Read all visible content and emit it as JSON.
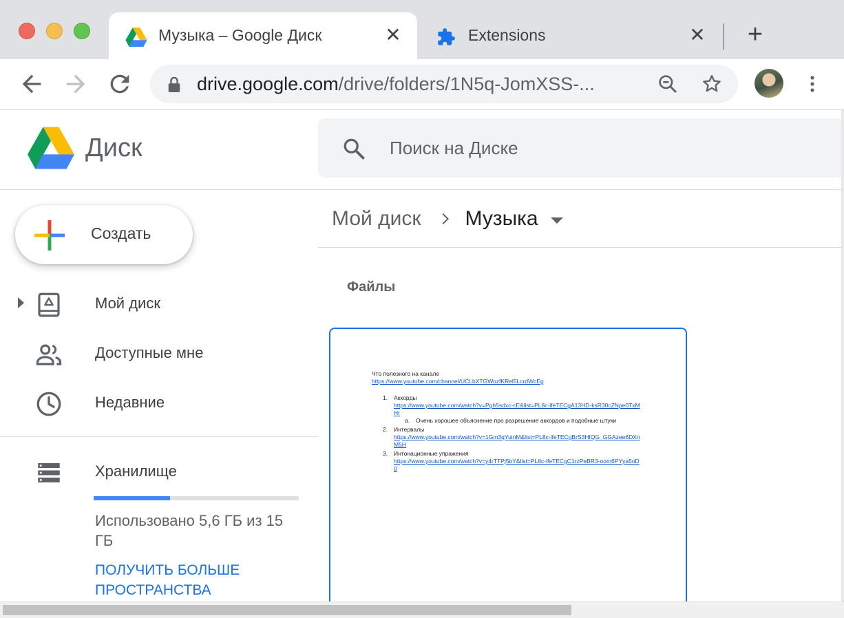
{
  "browser": {
    "tabs": [
      {
        "title": "Музыка – Google Диск",
        "close": "✕"
      },
      {
        "title": "Extensions",
        "close": "✕"
      }
    ],
    "new_tab": "+",
    "url_host": "drive.google.com",
    "url_path": "/drive/folders/1N5q-JomXSS-..."
  },
  "drive": {
    "app_name": "Диск",
    "search_placeholder": "Поиск на Диске",
    "create_label": "Создать",
    "nav": [
      {
        "label": "Мой диск",
        "icon": "my-drive-icon"
      },
      {
        "label": "Доступные мне",
        "icon": "shared-people-icon"
      },
      {
        "label": "Недавние",
        "icon": "clock-icon"
      }
    ],
    "storage": {
      "label": "Хранилище",
      "used_fraction": 0.373,
      "usage_text": "Использовано 5,6 ГБ из 15 ГБ",
      "get_more": "ПОЛУЧИТЬ БОЛЬШЕ ПРОСТРАНСТВА"
    },
    "breadcrumb": {
      "root": "Мой диск",
      "current": "Музыка"
    },
    "section_title": "Файлы",
    "document_preview": {
      "intro": "Что полезного на канале",
      "intro_link": "https://www.youtube.com/channel/UCLbXTGWozfKRel5LcrdWcEg",
      "items": [
        {
          "num": "1.",
          "title": "Аккорды",
          "link": "https://www.youtube.com/watch?v=Pgh5sdxc-cE&list=PL8c-lfeTECgA13HD-ksR30cZNpe0TxMHr",
          "sub": {
            "num": "a.",
            "text": "Очень хорошее объяснение про разрешение аккордов и подобные штуки"
          }
        },
        {
          "num": "2.",
          "title": "Интервалы",
          "link": "https://www.youtube.com/watch?v=1Gm3qYuinM&list=PL8c-lfeTECgBrS3HIQG_GGAzee6DXnM5H"
        },
        {
          "num": "3.",
          "title": "Интонационные упражения",
          "link": "https://www.youtube.com/watch?v=y4rTTPj5bY&list=PL8c-lfeTECgC1rzPeBR3-oom6PYya5oD0"
        }
      ]
    }
  }
}
